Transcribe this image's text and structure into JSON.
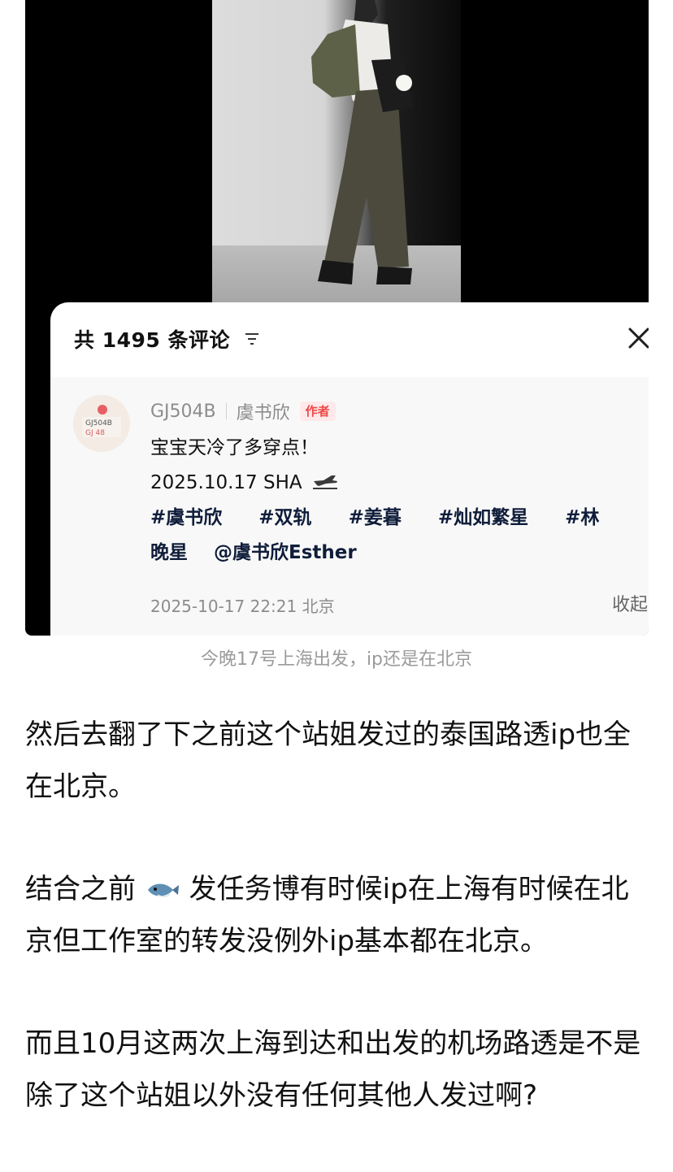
{
  "comment_panel": {
    "title": "共 1495 条评论",
    "collapse_label": "收起"
  },
  "comment": {
    "username": "GJ504B",
    "display_name": "虞书欣",
    "author_badge": "作者",
    "text_line_1": "宝宝天冷了多穿点！",
    "text_line_2": "2025.10.17 SHA",
    "tags": [
      "#虞书欣",
      "#双轨",
      "#姜暮",
      "#灿如繁星",
      "#林"
    ],
    "tag_continuation": "晚星",
    "mention": "@虞书欣Esther",
    "timestamp": "2025-10-17 22:21 北京"
  },
  "caption": "今晚17号上海出发，ip还是在北京",
  "article": {
    "paragraph_1": "然后去翻了下之前这个站姐发过的泰国路透ip也全在北京。",
    "paragraph_2_prefix": "结合之前",
    "paragraph_2_suffix": "发任务博有时候ip在上海有时候在北京但工作室的转发没例外ip基本都在北京。",
    "paragraph_3": "而且10月这两次上海到达和出发的机场路透是不是除了这个站姐以外没有任何其他人发过啊?"
  },
  "icons": {
    "filter": "filter-icon",
    "close": "close-icon",
    "avatar": "avatar",
    "plane": "airplane-departure-icon",
    "fish": "fish-icon"
  },
  "colors": {
    "author_badge": "#f04747",
    "tag": "#0f1d3a",
    "muted": "#8c8c8c"
  }
}
